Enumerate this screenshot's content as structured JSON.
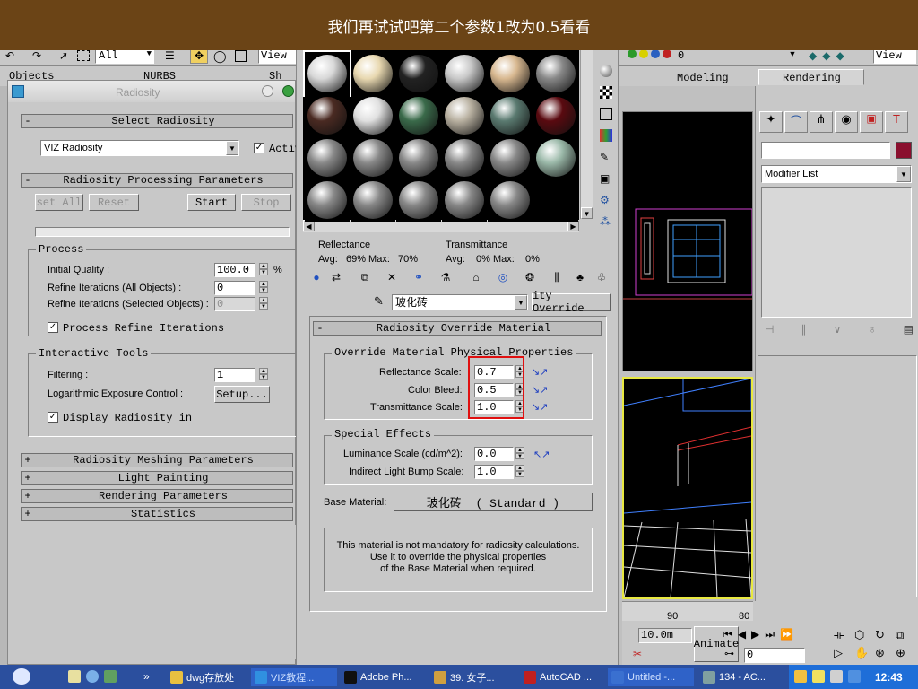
{
  "caption": "我们再试试吧第二个参数1改为0.5看看",
  "main_toolbar": {
    "filter": "All",
    "view_left": "View",
    "view_right": "View",
    "layer_value": "0"
  },
  "tabs": {
    "objects": "Objects",
    "nurbs": "NURBS",
    "sh": "Sh",
    "modeling": "Modeling",
    "rendering": "Rendering"
  },
  "radiosity": {
    "title": "Radiosity",
    "select_rollout": "Select Radiosity",
    "select_value": "VIZ Radiosity",
    "active_label": "Activ",
    "processing_rollout": "Radiosity Processing Parameters",
    "buttons": {
      "reset_all": "Reset All",
      "reset": "Reset",
      "start": "Start",
      "stop": "Stop"
    },
    "process_group": "Process",
    "initial_quality_label": "Initial Quality :",
    "initial_quality_value": "100.0",
    "initial_quality_unit": "%",
    "refine_all_label": "Refine Iterations (All Objects) :",
    "refine_all_value": "0",
    "refine_selected_label": "Refine Iterations (Selected Objects) :",
    "refine_selected_value": "0",
    "process_refine_label": "Process Refine Iterations",
    "interactive_group": "Interactive Tools",
    "filtering_label": "Filtering :",
    "filtering_value": "1",
    "log_exposure_label": "Logarithmic Exposure Control :",
    "setup_button": "Setup...",
    "display_radiosity_label": "Display Radiosity in",
    "collapsed_rollouts": [
      "Radiosity Meshing Parameters",
      "Light Painting",
      "Rendering Parameters",
      "Statistics"
    ]
  },
  "material_editor": {
    "reflectance_label": "Reflectance",
    "reflectance_values": "Avg:   69% Max:   70%",
    "transmittance_label": "Transmittance",
    "transmittance_values": "Avg:    0% Max:    0%",
    "material_name": "玻化砖",
    "material_type": "ity Override",
    "override_rollout": "Radiosity Override Material",
    "phys_group": "Override Material Physical Properties",
    "reflectance_scale_label": "Reflectance Scale:",
    "reflectance_scale_value": "0.7",
    "color_bleed_label": "Color Bleed:",
    "color_bleed_value": "0.5",
    "transmittance_scale_label": "Transmittance Scale:",
    "transmittance_scale_value": "1.0",
    "effects_group": "Special Effects",
    "luminance_label": "Luminance Scale (cd/m^2):",
    "luminance_value": "0.0",
    "bump_label": "Indirect Light Bump Scale:",
    "bump_value": "1.0",
    "base_material_label": "Base Material:",
    "base_material_value": "玻化砖  ( Standard )",
    "note_line1": "This material is not mandatory for radiosity calculations.",
    "note_line2": "Use it to override the physical properties",
    "note_line3": "of the Base Material when required."
  },
  "command_panel": {
    "modifier_list": "Modifier List",
    "swatch_color": "#8a0f2e"
  },
  "anim_bar": {
    "ruler_90": "90",
    "ruler_80": "80",
    "coord": "10.0m",
    "animate": "Animate",
    "frame": "0"
  },
  "taskbar": {
    "items": [
      "dwg存放处",
      "VIZ教程...",
      "Adobe Ph...",
      "39. 女子...",
      "AutoCAD ...",
      "Untitled -...",
      "134 - AC..."
    ],
    "clock": "12:43"
  }
}
